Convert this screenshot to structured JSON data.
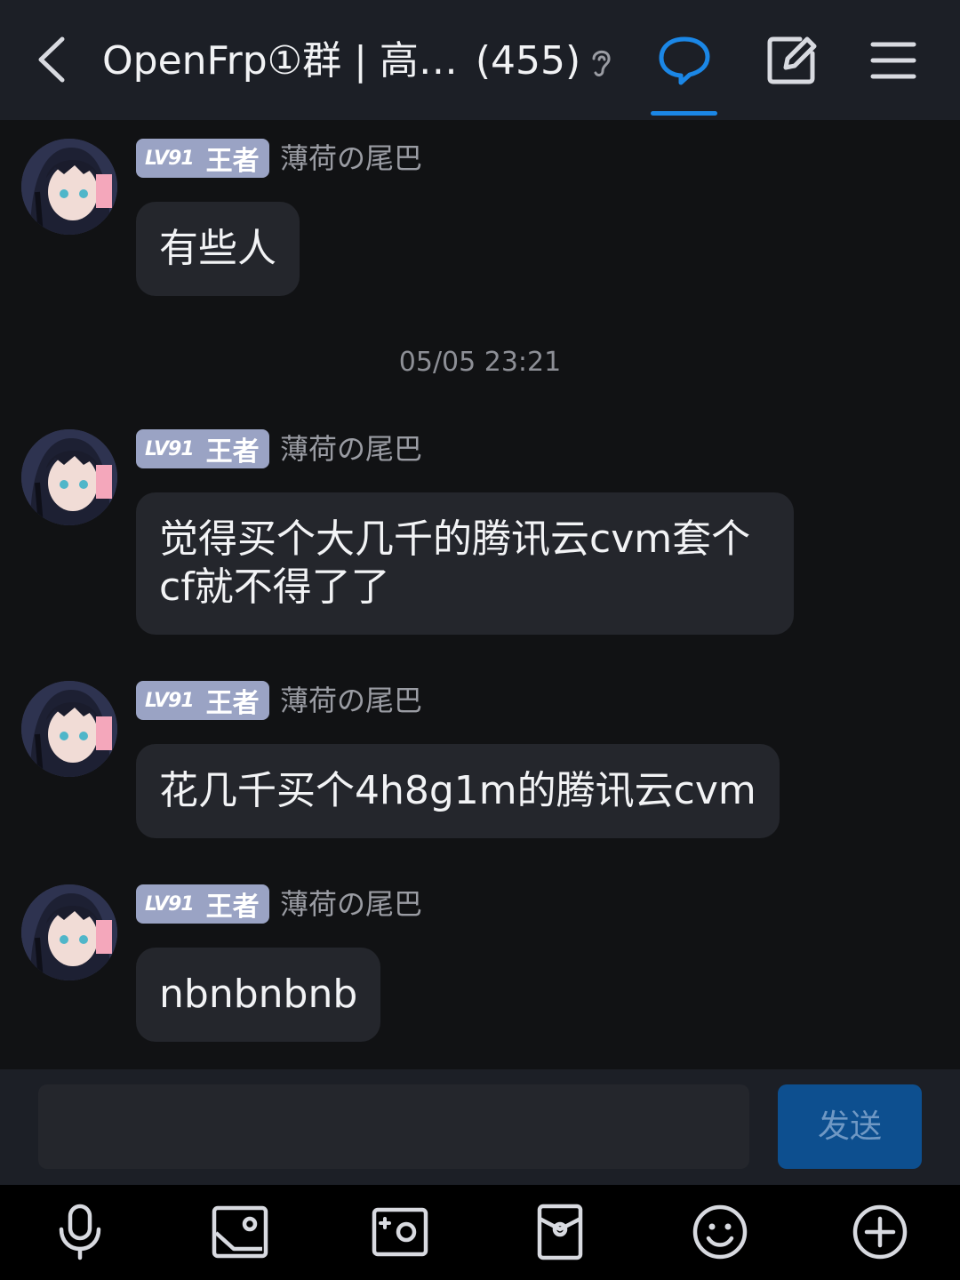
{
  "header": {
    "title": "OpenFrp①群 | 高…",
    "member_count": "(455)",
    "icons": [
      "back-icon",
      "ear-icon",
      "chat-bubble-icon",
      "edit-icon",
      "menu-icon"
    ]
  },
  "messages": [
    {
      "level": "LV91",
      "rank": "王者",
      "nickname": "薄荷の尾巴",
      "text": "有些人"
    },
    {
      "level": "LV91",
      "rank": "王者",
      "nickname": "薄荷の尾巴",
      "text": "觉得买个大几千的腾讯云cvm套个cf就不得了了"
    },
    {
      "level": "LV91",
      "rank": "王者",
      "nickname": "薄荷の尾巴",
      "text": "花几千买个4h8g1m的腾讯云cvm"
    },
    {
      "level": "LV91",
      "rank": "王者",
      "nickname": "薄荷の尾巴",
      "text": "nbnbnbnb"
    }
  ],
  "timestamp": "05/05 23:21",
  "input": {
    "value": "",
    "send_label": "发送"
  },
  "toolbar": {
    "icons": [
      "microphone-icon",
      "image-icon",
      "camera-icon",
      "red-packet-icon",
      "emoji-icon",
      "plus-icon"
    ]
  },
  "colors": {
    "header_bg": "#1c1f26",
    "chat_bg": "#111214",
    "bubble_bg": "#24262c",
    "accent": "#1b87e6",
    "badge_bg": "#9aa3c4",
    "send_button_bg": "#0d4f8f"
  }
}
